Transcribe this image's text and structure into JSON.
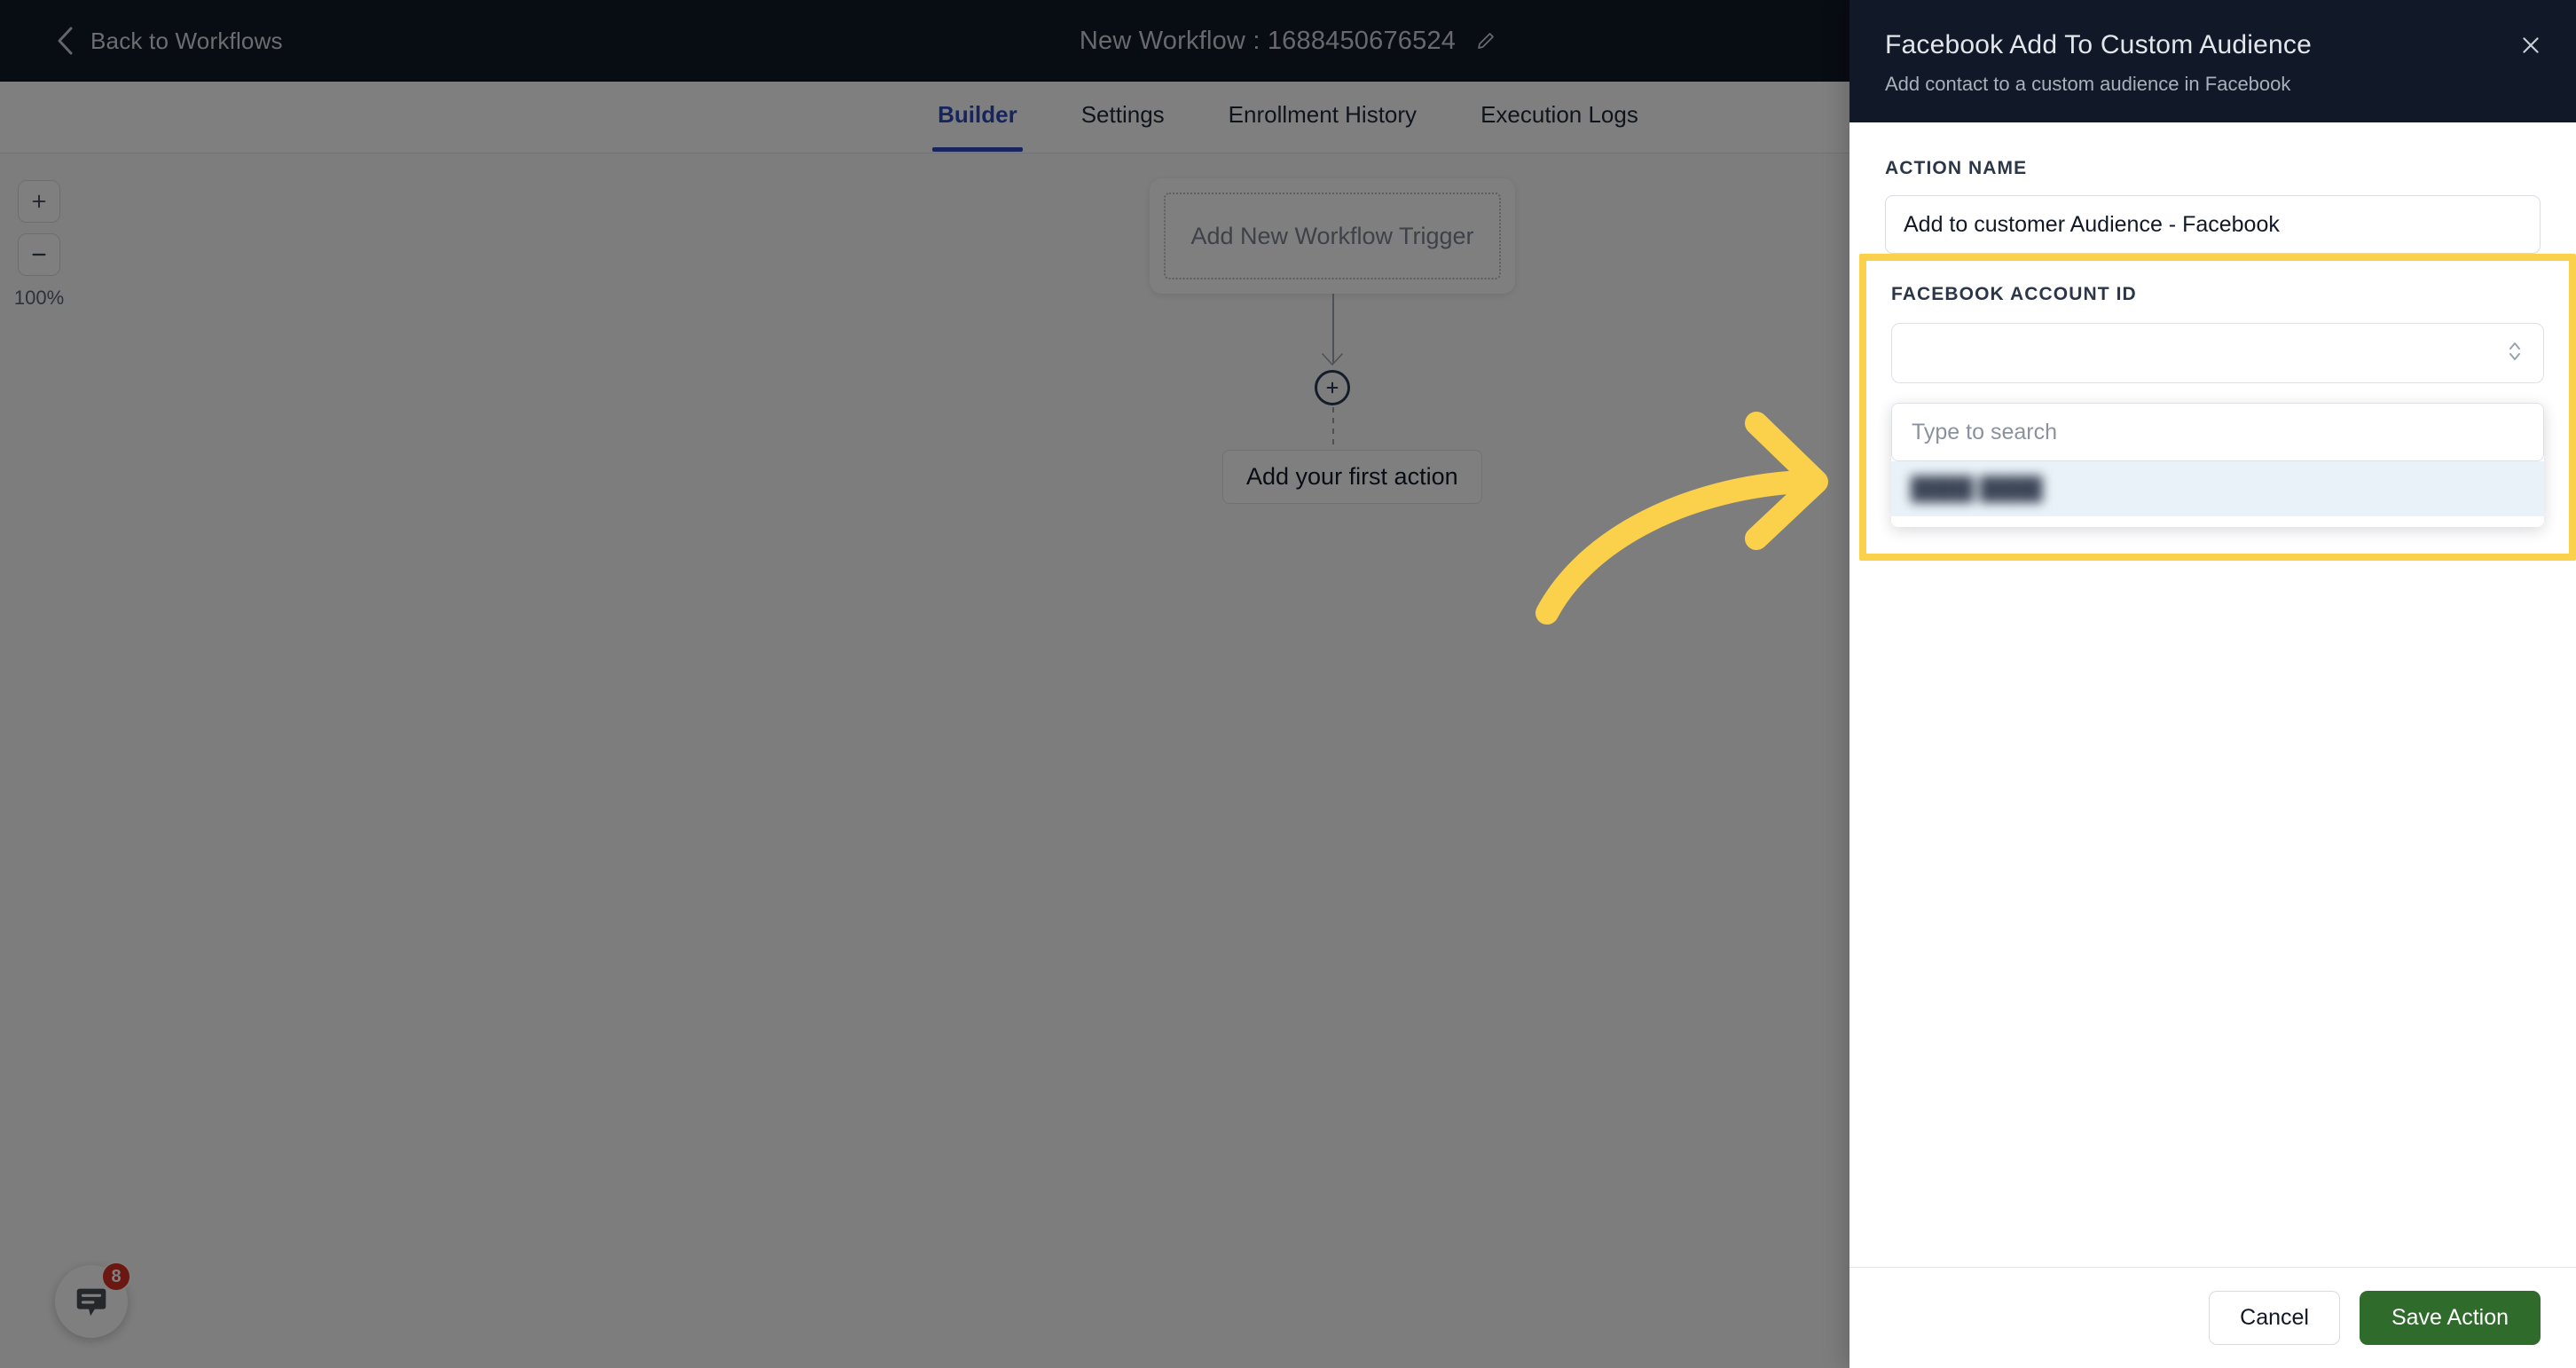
{
  "topbar": {
    "back_label": "Back to Workflows",
    "back_icon": "chevron-left-icon",
    "workflow_title": "New Workflow : 1688450676524",
    "edit_icon": "pencil-icon"
  },
  "tabs": [
    {
      "label": "Builder",
      "active": true
    },
    {
      "label": "Settings",
      "active": false
    },
    {
      "label": "Enrollment History",
      "active": false
    },
    {
      "label": "Execution Logs",
      "active": false
    }
  ],
  "canvas": {
    "zoom": {
      "in_label": "+",
      "out_label": "−",
      "level": "100%"
    },
    "trigger_node": "Add New Workflow Trigger",
    "add_node_icon": "plus-circle-icon",
    "first_action_label": "Add your first action"
  },
  "chat_widget": {
    "icon": "chat-bubble-icon",
    "badge_count": "8"
  },
  "panel": {
    "title": "Facebook Add To Custom Audience",
    "subtitle": "Add contact to a custom audience in Facebook",
    "close_icon": "close-icon",
    "action_name": {
      "label": "ACTION NAME",
      "value": "Add to customer Audience - Facebook",
      "placeholder": "Action name"
    },
    "facebook_account": {
      "label": "FACEBOOK ACCOUNT ID",
      "selected_value": "",
      "stepper_icon": "chevron-up-down-icon",
      "dropdown": {
        "search_placeholder": "Type to search",
        "search_value": "",
        "options": [
          {
            "label": "████ ████",
            "redacted": true,
            "highlighted": true
          }
        ]
      }
    },
    "footer": {
      "cancel_label": "Cancel",
      "save_label": "Save Action"
    }
  },
  "annotation": {
    "arrow_icon": "curved-arrow-right-icon",
    "highlight_color": "#fbd14b"
  }
}
